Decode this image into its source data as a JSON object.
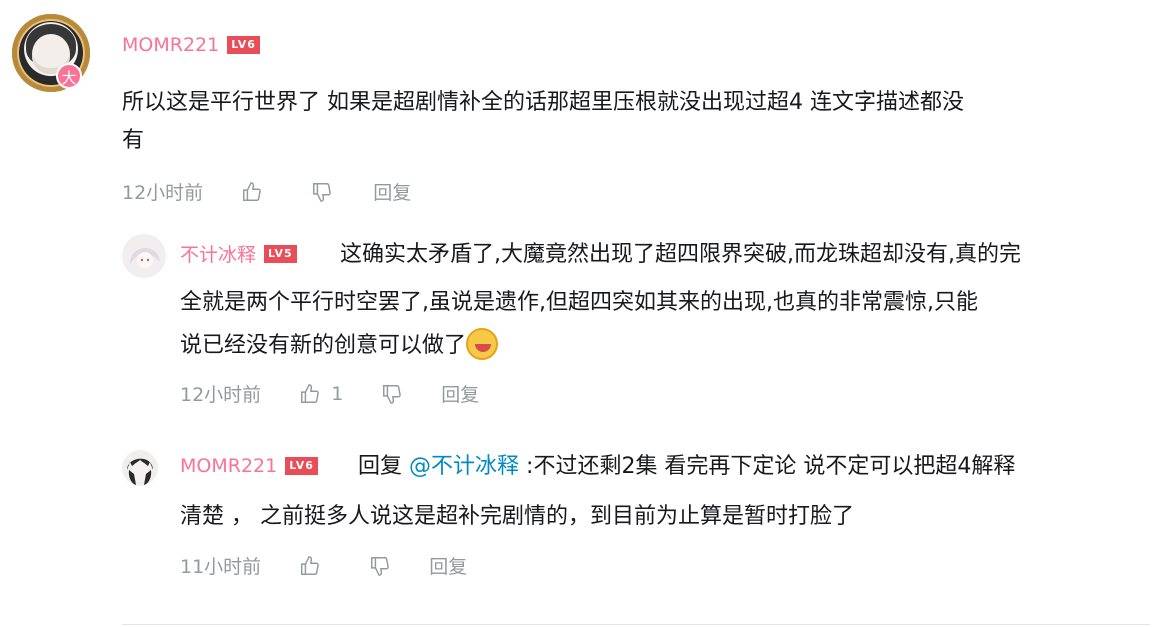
{
  "comment": {
    "username": "MOMR221",
    "level": "LV6",
    "avatar_badge": "大",
    "text_line1": "所以这是平行世界了  如果是超剧情补全的话那超里压根就没出现过超4 连文字描述都没",
    "text_line2": "有",
    "time": "12小时前",
    "reply_label": "回复"
  },
  "replies": [
    {
      "username": "不计冰释",
      "level": "LV5",
      "line1": "这确实太矛盾了,大魔竟然出现了超四限界突破,而龙珠超却没有,真的完",
      "line2": "全就是两个平行时空罢了,虽说是遗作,但超四突如其来的出现,也真的非常震惊,只能",
      "line3": "说已经没有新的创意可以做了",
      "emoji_name": "laughing-crying-emoji",
      "time": "12小时前",
      "likes": "1",
      "reply_label": "回复"
    },
    {
      "username": "MOMR221",
      "level": "LV6",
      "reply_prefix": "回复",
      "mention": "@不计冰释",
      "line1": ":不过还剩2集 看完再下定论 说不定可以把超4解释",
      "line2": "清楚 ， 之前挺多人说这是超补完剧情的，到目前为止算是暂时打脸了",
      "time": "11小时前",
      "reply_label": "回复"
    }
  ],
  "colors": {
    "username": "#fb7299",
    "meta": "#9499a0",
    "mention": "#008ac5",
    "level_badge": "#e94d58"
  }
}
